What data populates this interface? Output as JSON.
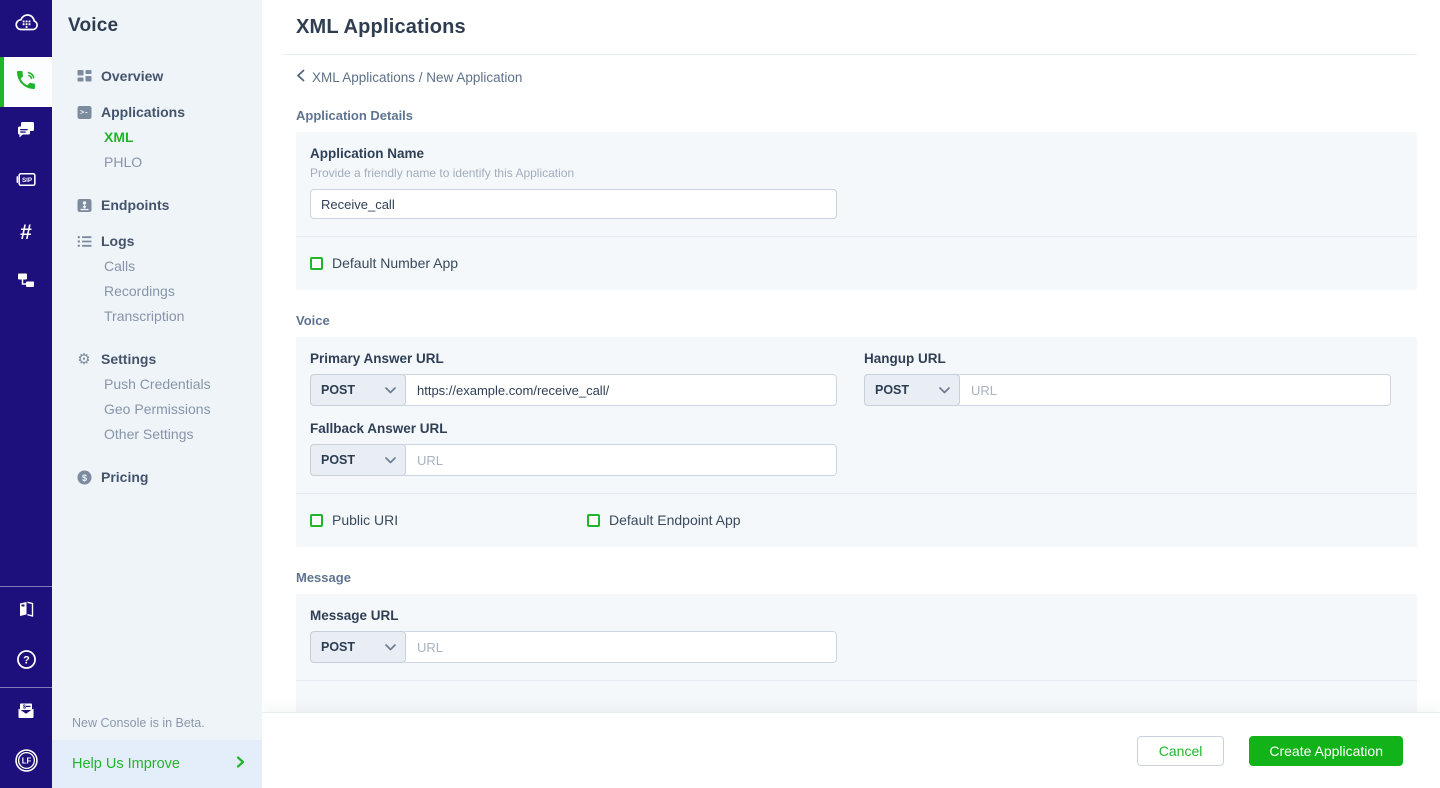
{
  "colors": {
    "rail_bg": "#1d0f7c",
    "accent_green": "#21b52b",
    "button_green": "#12b318",
    "sidebar_bg": "#eff4f9",
    "card_bg": "#f5f8fb"
  },
  "rail": {
    "active_icon": "voice",
    "hash_glyph": "#",
    "sip_label": "SIP",
    "question_glyph": "?",
    "avatar_initials": "LF"
  },
  "sidebar": {
    "title": "Voice",
    "groups": [
      {
        "label": "Overview"
      },
      {
        "label": "Applications",
        "children": [
          "XML",
          "PHLO"
        ],
        "active_child": "XML"
      },
      {
        "label": "Endpoints"
      },
      {
        "label": "Logs",
        "children": [
          "Calls",
          "Recordings",
          "Transcription"
        ]
      },
      {
        "label": "Settings",
        "children": [
          "Push Credentials",
          "Geo Permissions",
          "Other Settings"
        ]
      },
      {
        "label": "Pricing"
      }
    ],
    "beta_note": "New Console is in Beta.",
    "help_link": "Help Us Improve"
  },
  "main": {
    "title": "XML Applications",
    "breadcrumb": "XML Applications / New Application",
    "details": {
      "section_label": "Application Details",
      "name_label": "Application Name",
      "name_help": "Provide a friendly name to identify this Application",
      "name_value": "Receive_call",
      "default_number_app_label": "Default Number App",
      "default_number_app_checked": false
    },
    "voice": {
      "section_label": "Voice",
      "primary_label": "Primary Answer URL",
      "primary_method": "POST",
      "primary_url": "https://example.com/receive_call/",
      "hangup_label": "Hangup URL",
      "hangup_method": "POST",
      "fallback_label": "Fallback Answer URL",
      "fallback_method": "POST",
      "url_placeholder": "URL",
      "public_uri_label": "Public URI",
      "public_uri_checked": false,
      "default_endpoint_app_label": "Default Endpoint App",
      "default_endpoint_app_checked": false
    },
    "message": {
      "section_label": "Message",
      "url_label": "Message URL",
      "method": "POST",
      "url_placeholder": "URL"
    },
    "footer": {
      "cancel_label": "Cancel",
      "create_label": "Create Application"
    }
  }
}
